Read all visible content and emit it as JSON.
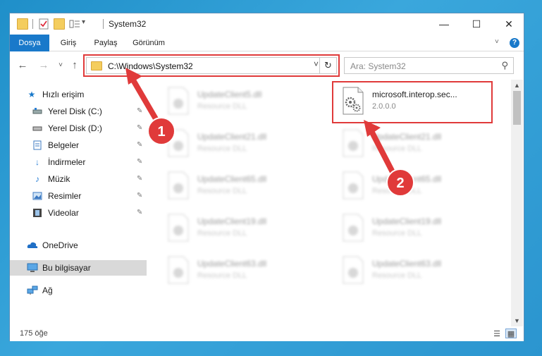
{
  "window": {
    "title": "System32",
    "controls": {
      "minimize": "—",
      "maximize": "☐",
      "close": "✕"
    }
  },
  "quick_access_toolbar": {
    "icons": [
      "folder-icon",
      "properties-icon",
      "new-folder-icon",
      "customize-icon"
    ],
    "dropdown": "▾"
  },
  "ribbon": {
    "tabs": [
      {
        "label": "Dosya",
        "active": true
      },
      {
        "label": "Giriş",
        "active": false
      },
      {
        "label": "Paylaş",
        "active": false
      },
      {
        "label": "Görünüm",
        "active": false
      }
    ],
    "expand": "˅",
    "help": "?"
  },
  "navigation": {
    "back": "←",
    "forward": "→",
    "recent": "˅",
    "up": "↑"
  },
  "address_bar": {
    "path": "C:\\Windows\\System32",
    "dropdown": "˅",
    "refresh": "↻"
  },
  "search": {
    "placeholder": "Ara: System32",
    "icon": "⚲"
  },
  "sidebar": {
    "items": [
      {
        "label": "Hızlı erişim",
        "icon": "star-icon",
        "pinned": false,
        "selected": false
      },
      {
        "label": "Yerel Disk (C:)",
        "icon": "drive-icon",
        "pinned": true,
        "selected": false
      },
      {
        "label": "Yerel Disk (D:)",
        "icon": "drive-icon",
        "pinned": true,
        "selected": false
      },
      {
        "label": "Belgeler",
        "icon": "documents-icon",
        "pinned": true,
        "selected": false
      },
      {
        "label": "İndirmeler",
        "icon": "download-icon",
        "pinned": true,
        "selected": false
      },
      {
        "label": "Müzik",
        "icon": "music-icon",
        "pinned": true,
        "selected": false
      },
      {
        "label": "Resimler",
        "icon": "pictures-icon",
        "pinned": true,
        "selected": false
      },
      {
        "label": "Videolar",
        "icon": "video-icon",
        "pinned": true,
        "selected": false
      },
      {
        "label": "OneDrive",
        "icon": "cloud-icon",
        "pinned": false,
        "selected": false
      },
      {
        "label": "Bu bilgisayar",
        "icon": "computer-icon",
        "pinned": false,
        "selected": true
      },
      {
        "label": "Ağ",
        "icon": "network-icon",
        "pinned": false,
        "selected": false
      }
    ],
    "pin_glyph": "📌"
  },
  "files": [
    {
      "name": "UpdateClient5.dll",
      "type": "Resource DLL",
      "blurred": true
    },
    {
      "name": "microsoft.interop.sec...",
      "type": "2.0.0.0",
      "blurred": false
    },
    {
      "name": "UpdateClient21.dll",
      "type": "Resource DLL",
      "blurred": true
    },
    {
      "name": "UpdateClient21.dll",
      "type": "Resource DLL",
      "blurred": true
    },
    {
      "name": "UpdateClient65.dll",
      "type": "Resource DLL",
      "blurred": true
    },
    {
      "name": "UpdateClient65.dll",
      "type": "Resource DLL",
      "blurred": true
    },
    {
      "name": "UpdateClient19.dll",
      "type": "Resource DLL",
      "blurred": true
    },
    {
      "name": "UpdateClient19.dll",
      "type": "Resource DLL",
      "blurred": true
    },
    {
      "name": "UpdateClient63.dll",
      "type": "Resource DLL",
      "blurred": true
    },
    {
      "name": "UpdateClient63.dll",
      "type": "Resource DLL",
      "blurred": true
    }
  ],
  "scrollbar": {
    "up": "▲",
    "down": "▼"
  },
  "status": {
    "item_count": "175 öğe",
    "details_view": "☰",
    "icons_view": "▦"
  },
  "annotations": [
    {
      "number": "1",
      "target": "address-bar"
    },
    {
      "number": "2",
      "target": "selected-file"
    }
  ],
  "colors": {
    "accent": "#1979ca",
    "callout": "#e03a3a",
    "folder": "#f4cd5e",
    "selected_bg": "#d9d9d9"
  }
}
